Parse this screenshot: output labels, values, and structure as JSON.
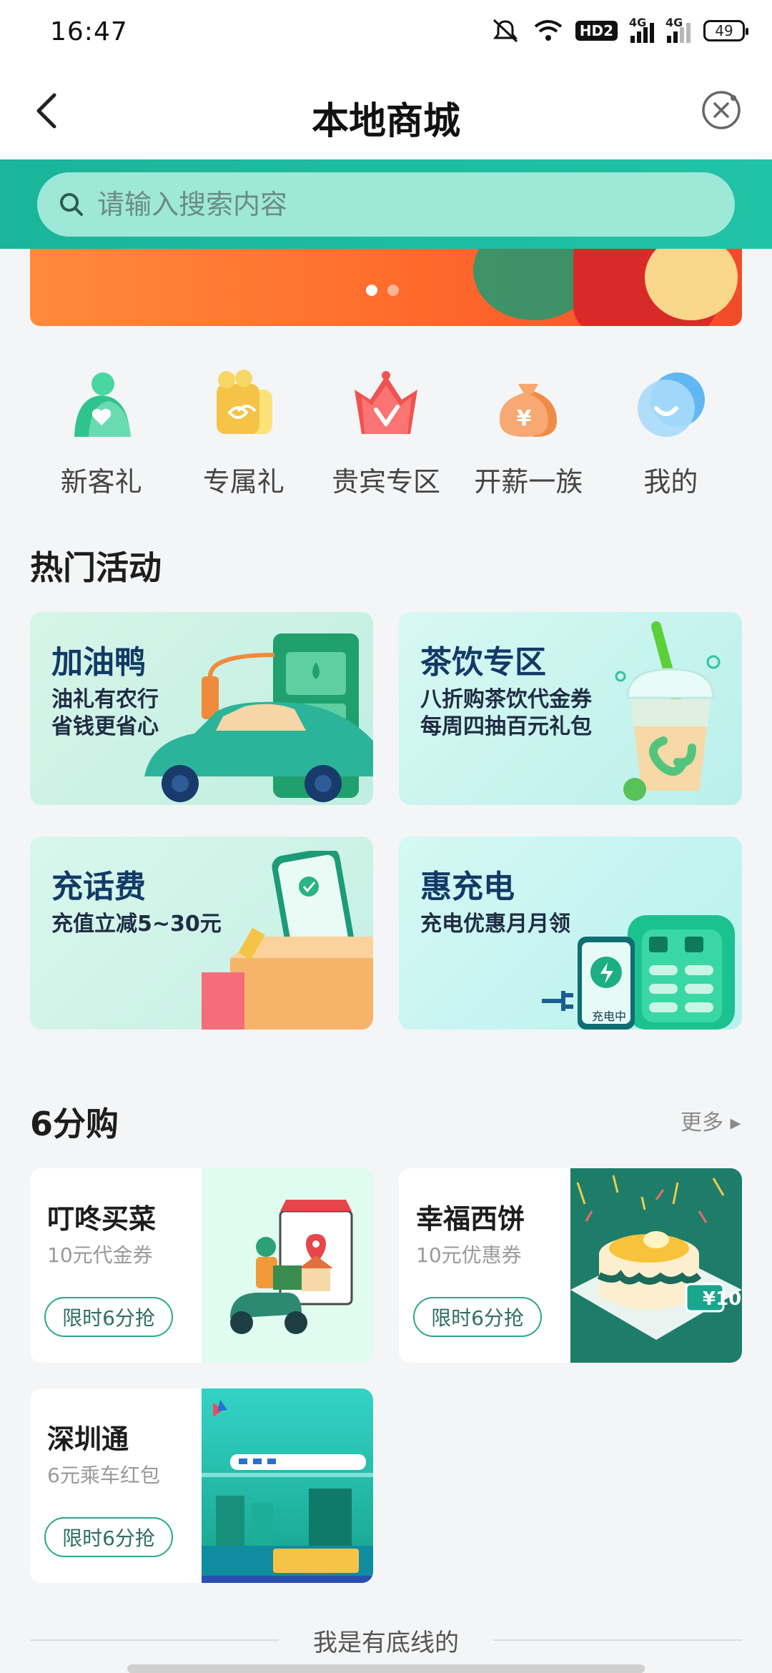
{
  "status_bar": {
    "time": "16:47",
    "hd": "HD2",
    "net1": "4G",
    "net2": "4G",
    "battery": "49"
  },
  "header": {
    "title": "本地商城"
  },
  "search": {
    "placeholder": "请输入搜索内容"
  },
  "banner": {
    "dots": 2,
    "active_dot": 1
  },
  "categories": [
    {
      "label": "新客礼",
      "icon": "gift-bag-icon",
      "color": "#2fc38f"
    },
    {
      "label": "专属礼",
      "icon": "gift-box-icon",
      "color": "#f5c446"
    },
    {
      "label": "贵宾专区",
      "icon": "crown-icon",
      "color": "#f0524f"
    },
    {
      "label": "开薪一族",
      "icon": "money-bag-icon",
      "color": "#f49256"
    },
    {
      "label": "我的",
      "icon": "smile-bubble-icon",
      "color": "#5fb8f2"
    }
  ],
  "hot": {
    "title": "热门活动",
    "cards": [
      {
        "title": "加油鸭",
        "sub1": "油礼有农行",
        "sub2": "省钱更省心"
      },
      {
        "title": "茶饮专区",
        "sub1": "八折购茶饮代金券",
        "sub2": "每周四抽百元礼包"
      },
      {
        "title": "充话费",
        "sub1": "充值立减5~30元",
        "sub2": ""
      },
      {
        "title": "惠充电",
        "sub1": "充电优惠月月领",
        "sub2": "",
        "badge": "充电中"
      }
    ]
  },
  "six": {
    "title": "6分购",
    "more": "更多 ▸",
    "cards": [
      {
        "title": "叮咚买菜",
        "sub": "10元代金券",
        "btn": "限时6分抢"
      },
      {
        "title": "幸福西饼",
        "sub": "10元优惠券",
        "btn": "限时6分抢",
        "tag": "¥10"
      },
      {
        "title": "深圳通",
        "sub": "6元乘车红包",
        "btn": "限时6分抢"
      }
    ]
  },
  "footer": {
    "text": "我是有底线的"
  }
}
